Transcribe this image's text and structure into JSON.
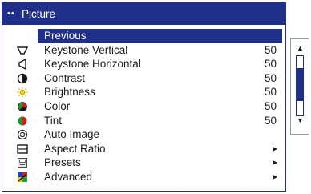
{
  "colors": {
    "accent": "#1f2f8a",
    "background": "#ffffff",
    "text": "#1a1a1a"
  },
  "menu": {
    "title": "Picture",
    "title_dots": "••",
    "items": [
      {
        "label": "Previous",
        "value": "",
        "icon": "none",
        "selected": true
      },
      {
        "label": "Keystone Vertical",
        "value": "50",
        "icon": "keystone-vertical-icon"
      },
      {
        "label": "Keystone Horizontal",
        "value": "50",
        "icon": "keystone-horizontal-icon"
      },
      {
        "label": "Contrast",
        "value": "50",
        "icon": "contrast-icon"
      },
      {
        "label": "Brightness",
        "value": "50",
        "icon": "brightness-icon"
      },
      {
        "label": "Color",
        "value": "50",
        "icon": "color-icon"
      },
      {
        "label": "Tint",
        "value": "50",
        "icon": "tint-icon"
      },
      {
        "label": "Auto Image",
        "value": "",
        "icon": "auto-image-icon"
      },
      {
        "label": "Aspect Ratio",
        "value": "",
        "icon": "aspect-ratio-icon",
        "submenu_arrow": "▶"
      },
      {
        "label": "Presets",
        "value": "",
        "icon": "presets-icon",
        "submenu_arrow": "▶"
      },
      {
        "label": "Advanced",
        "value": "",
        "icon": "advanced-icon",
        "submenu_arrow": "▶"
      }
    ]
  },
  "scrollbar": {
    "up_arrow": "▲",
    "down_arrow": "▼",
    "thumb_fraction": 0.55,
    "position_fraction": 0.45
  }
}
